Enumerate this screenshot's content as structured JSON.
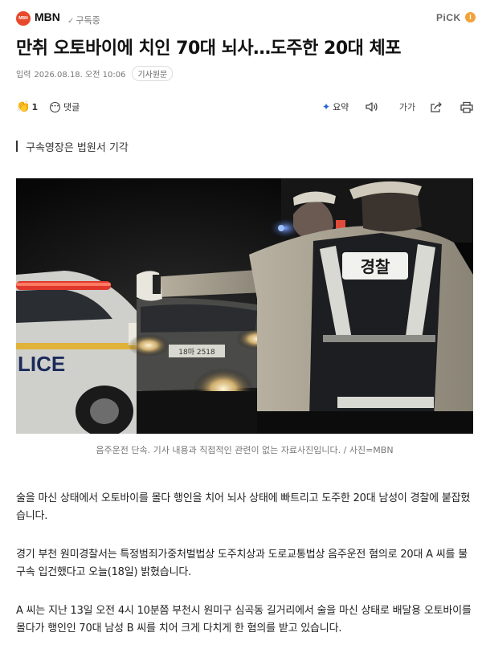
{
  "press": {
    "logo_text": "MBN",
    "name": "MBN",
    "subscribe_label": "구독중"
  },
  "header": {
    "pick_label": "PiCK",
    "info_icon_label": "i"
  },
  "article": {
    "headline": "만취 오토바이에 치인 70대 뇌사…도주한 20대 체포",
    "date_label": "입력",
    "date": "2026.08.18. 오전 10:06",
    "original_button": "기사원문",
    "subtitle": "구속영장은 법원서 기각",
    "photo": {
      "vest_text": "경찰",
      "car_text": "LICE",
      "plate_text": "18마 2518"
    },
    "caption": "음주운전 단속. 기사 내용과 직접적인 관련이 없는 자료사진입니다. / 사진=MBN",
    "paragraphs": [
      "술을 마신 상태에서 오토바이를 몰다 행인을 치어 뇌사 상태에 빠트리고 도주한 20대 남성이 경찰에 붙잡혔습니다.",
      "경기 부천 원미경찰서는 특정범죄가중처벌법상 도주치상과 도로교통법상 음주운전 혐의로 20대 A 씨를 불구속 입건했다고 오늘(18일) 밝혔습니다.",
      "A 씨는 지난 13일 오전 4시 10분쯤 부천시 원미구 심곡동 길거리에서 술을 마신 상태로 배달용 오토바이를 몰다가 행인인 70대 남성 B 씨를 치어 크게 다치게 한 혐의를 받고 있습니다."
    ]
  },
  "actions": {
    "clap_icon": "clap-icon",
    "clap_count": "1",
    "comment_label": "댓글",
    "summary_label": "요약",
    "font_label": "가가"
  },
  "colors": {
    "brand": "#e8482b",
    "accent_blue": "#2463d6",
    "info_orange": "#f2a23a"
  }
}
